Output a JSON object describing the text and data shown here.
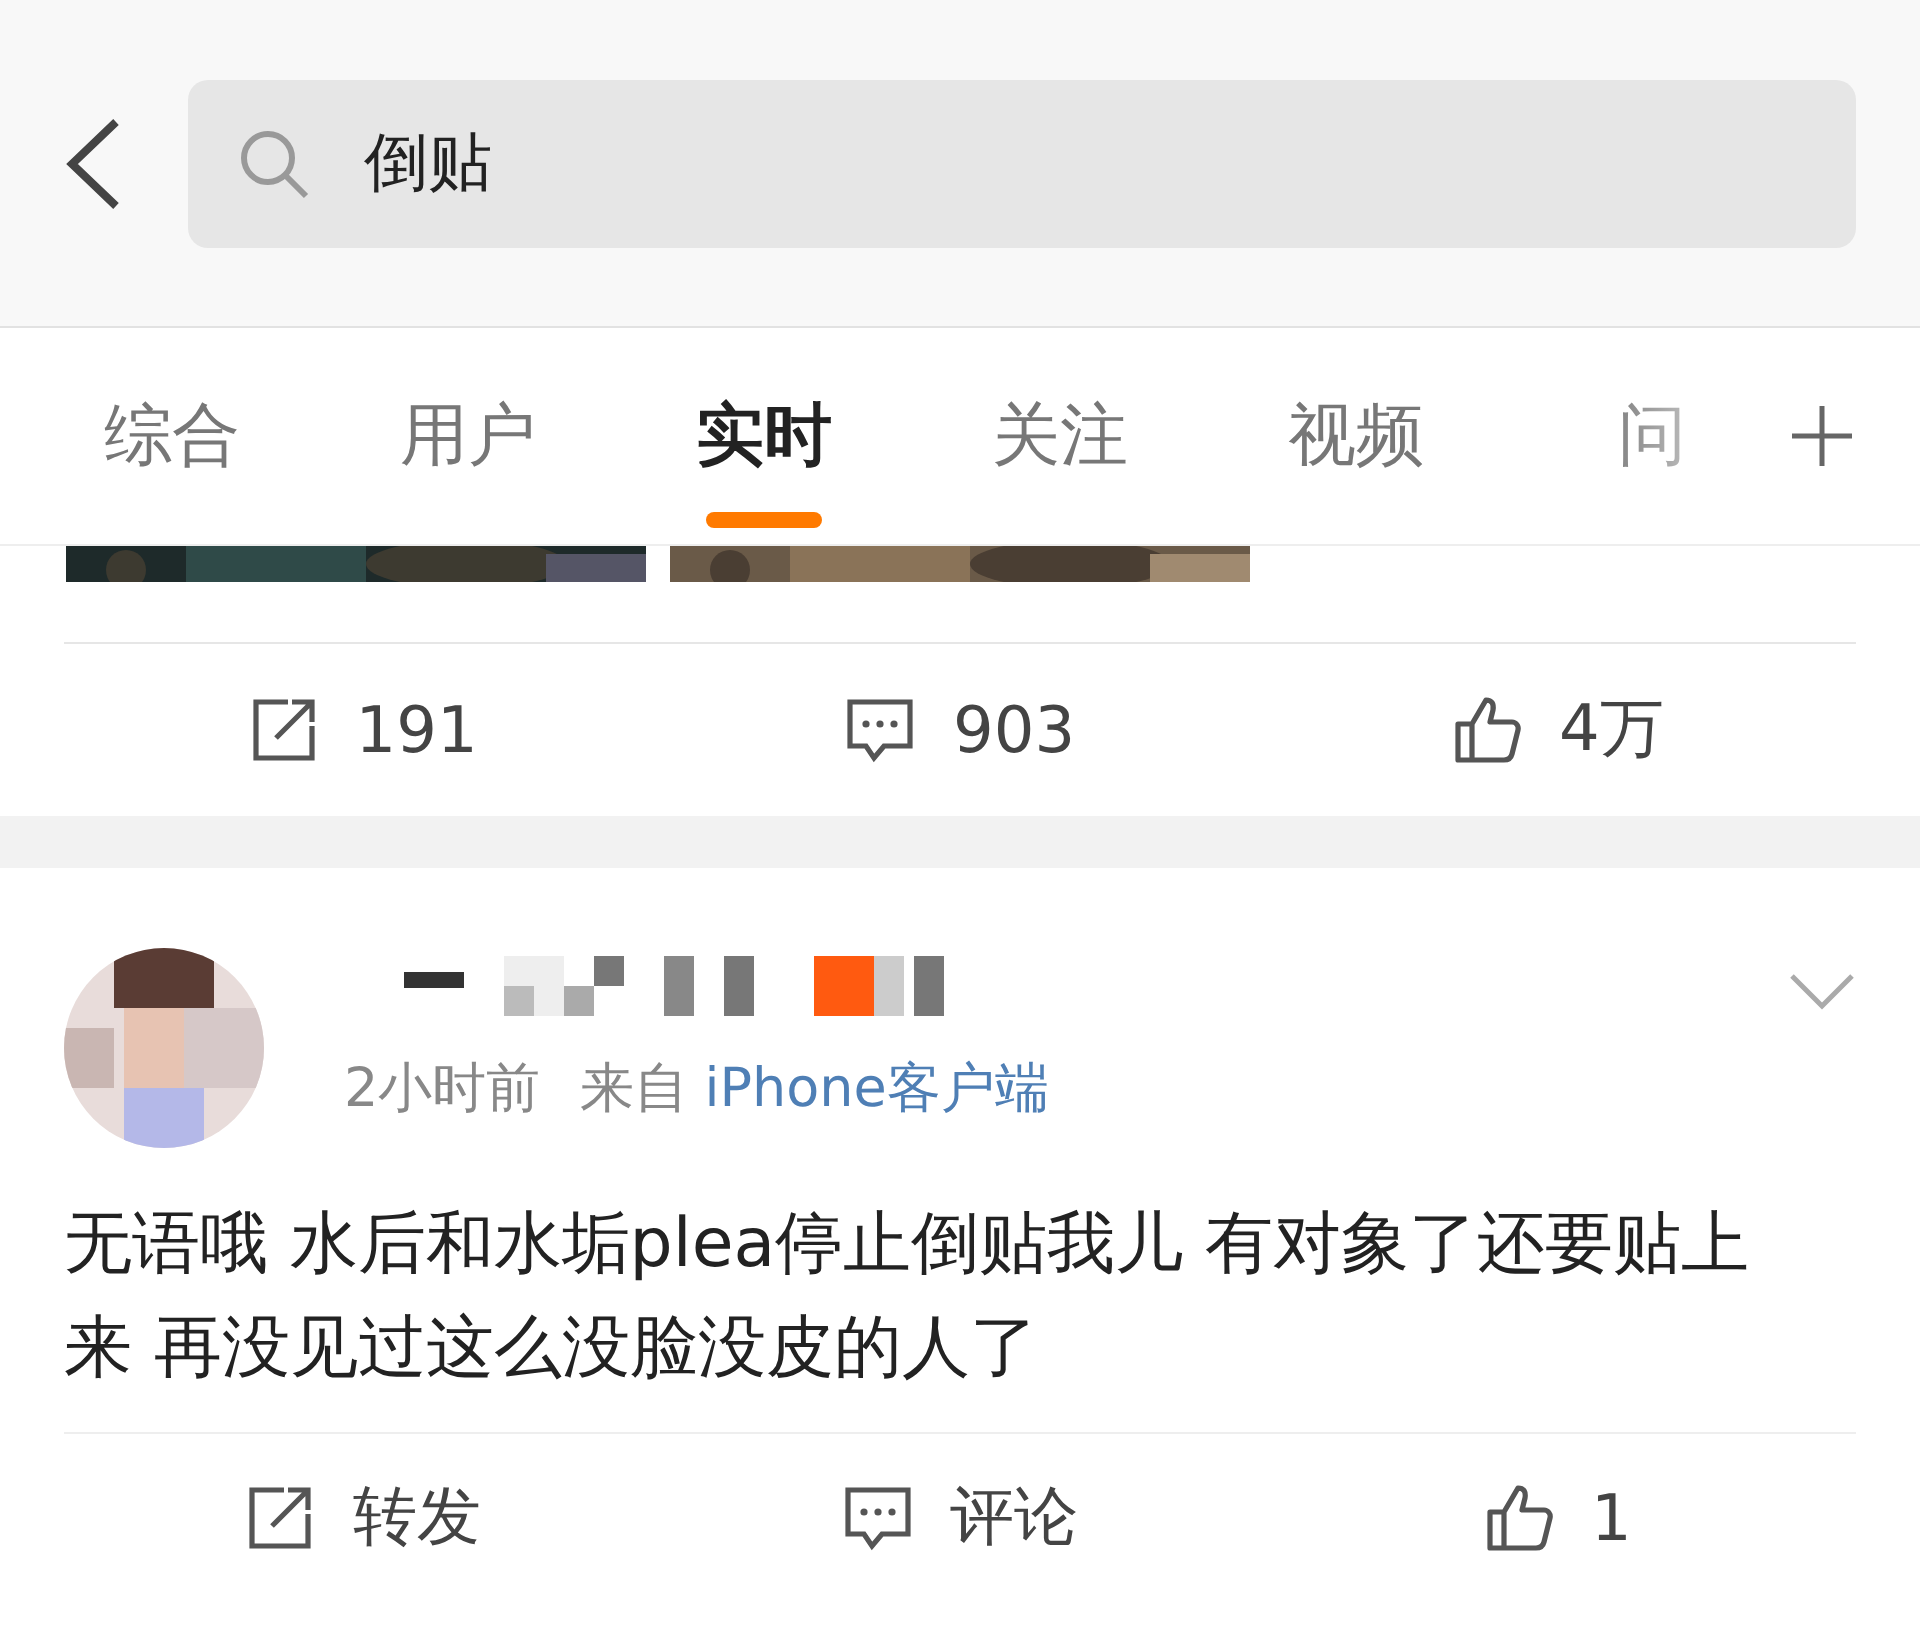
{
  "search": {
    "value": "倒贴"
  },
  "tabs": [
    {
      "label": "综合",
      "selected": false
    },
    {
      "label": "用户",
      "selected": false
    },
    {
      "label": "实时",
      "selected": true
    },
    {
      "label": "关注",
      "selected": false
    },
    {
      "label": "视频",
      "selected": false
    },
    {
      "label": "问",
      "selected": false
    }
  ],
  "previous_post": {
    "actions": [
      {
        "kind": "repost",
        "label": "191"
      },
      {
        "kind": "comment",
        "label": "903"
      },
      {
        "kind": "like",
        "label": "4万"
      }
    ]
  },
  "post": {
    "time": "2小时前",
    "source_prefix": "来自",
    "source": "iPhone客户端",
    "text": "无语哦 水后和水垢plea停止倒贴我儿 有对象了还要贴上来 再没见过这么没脸没皮的人了",
    "actions": [
      {
        "kind": "repost",
        "label": "转发"
      },
      {
        "kind": "comment",
        "label": "评论"
      },
      {
        "kind": "like",
        "label": "1"
      }
    ]
  }
}
